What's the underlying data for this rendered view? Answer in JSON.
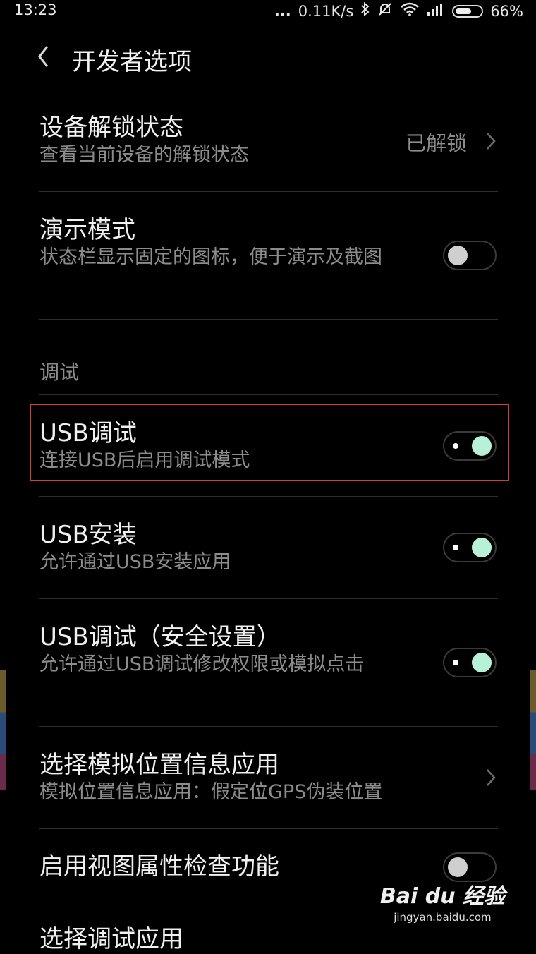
{
  "status_bar": {
    "time": "13:23",
    "dots": "...",
    "net_speed": "0.11K/s",
    "icons": [
      "bluetooth-icon",
      "alarm-off-icon",
      "wifi-icon",
      "signal-icon",
      "battery-icon"
    ],
    "battery_percent": "66%",
    "battery_level": 0.66
  },
  "header": {
    "title": "开发者选项",
    "back_icon": "chevron-left-icon"
  },
  "items": {
    "unlock": {
      "title": "设备解锁状态",
      "subtitle": "查看当前设备的解锁状态",
      "value": "已解锁"
    },
    "demo": {
      "title": "演示模式",
      "subtitle": "状态栏显示固定的图标，便于演示及截图",
      "toggle": "off"
    },
    "section": "调试",
    "usb_debug": {
      "title": "USB调试",
      "subtitle": "连接USB后启用调试模式",
      "toggle": "on"
    },
    "usb_install": {
      "title": "USB安装",
      "subtitle": "允许通过USB安装应用",
      "toggle": "on"
    },
    "usb_debug_secure": {
      "title": "USB调试（安全设置）",
      "subtitle": "允许通过USB调试修改权限或模拟点击",
      "toggle": "on"
    },
    "mock_location": {
      "title": "选择模拟位置信息应用",
      "subtitle": "模拟位置信息应用：假定位GPS伪装位置"
    },
    "view_attr": {
      "title": "启用视图属性检查功能",
      "toggle": "off"
    },
    "select_debug_app": {
      "title": "选择调试应用"
    }
  },
  "watermark": {
    "logo": "Bai du 经验",
    "sub": "jingyan.baidu.com"
  },
  "colors": {
    "toggle_on": "#b6f1d8",
    "toggle_off": "#cfcfcf",
    "highlight": "#d63a3a",
    "subtitle": "#8c8c8c"
  }
}
